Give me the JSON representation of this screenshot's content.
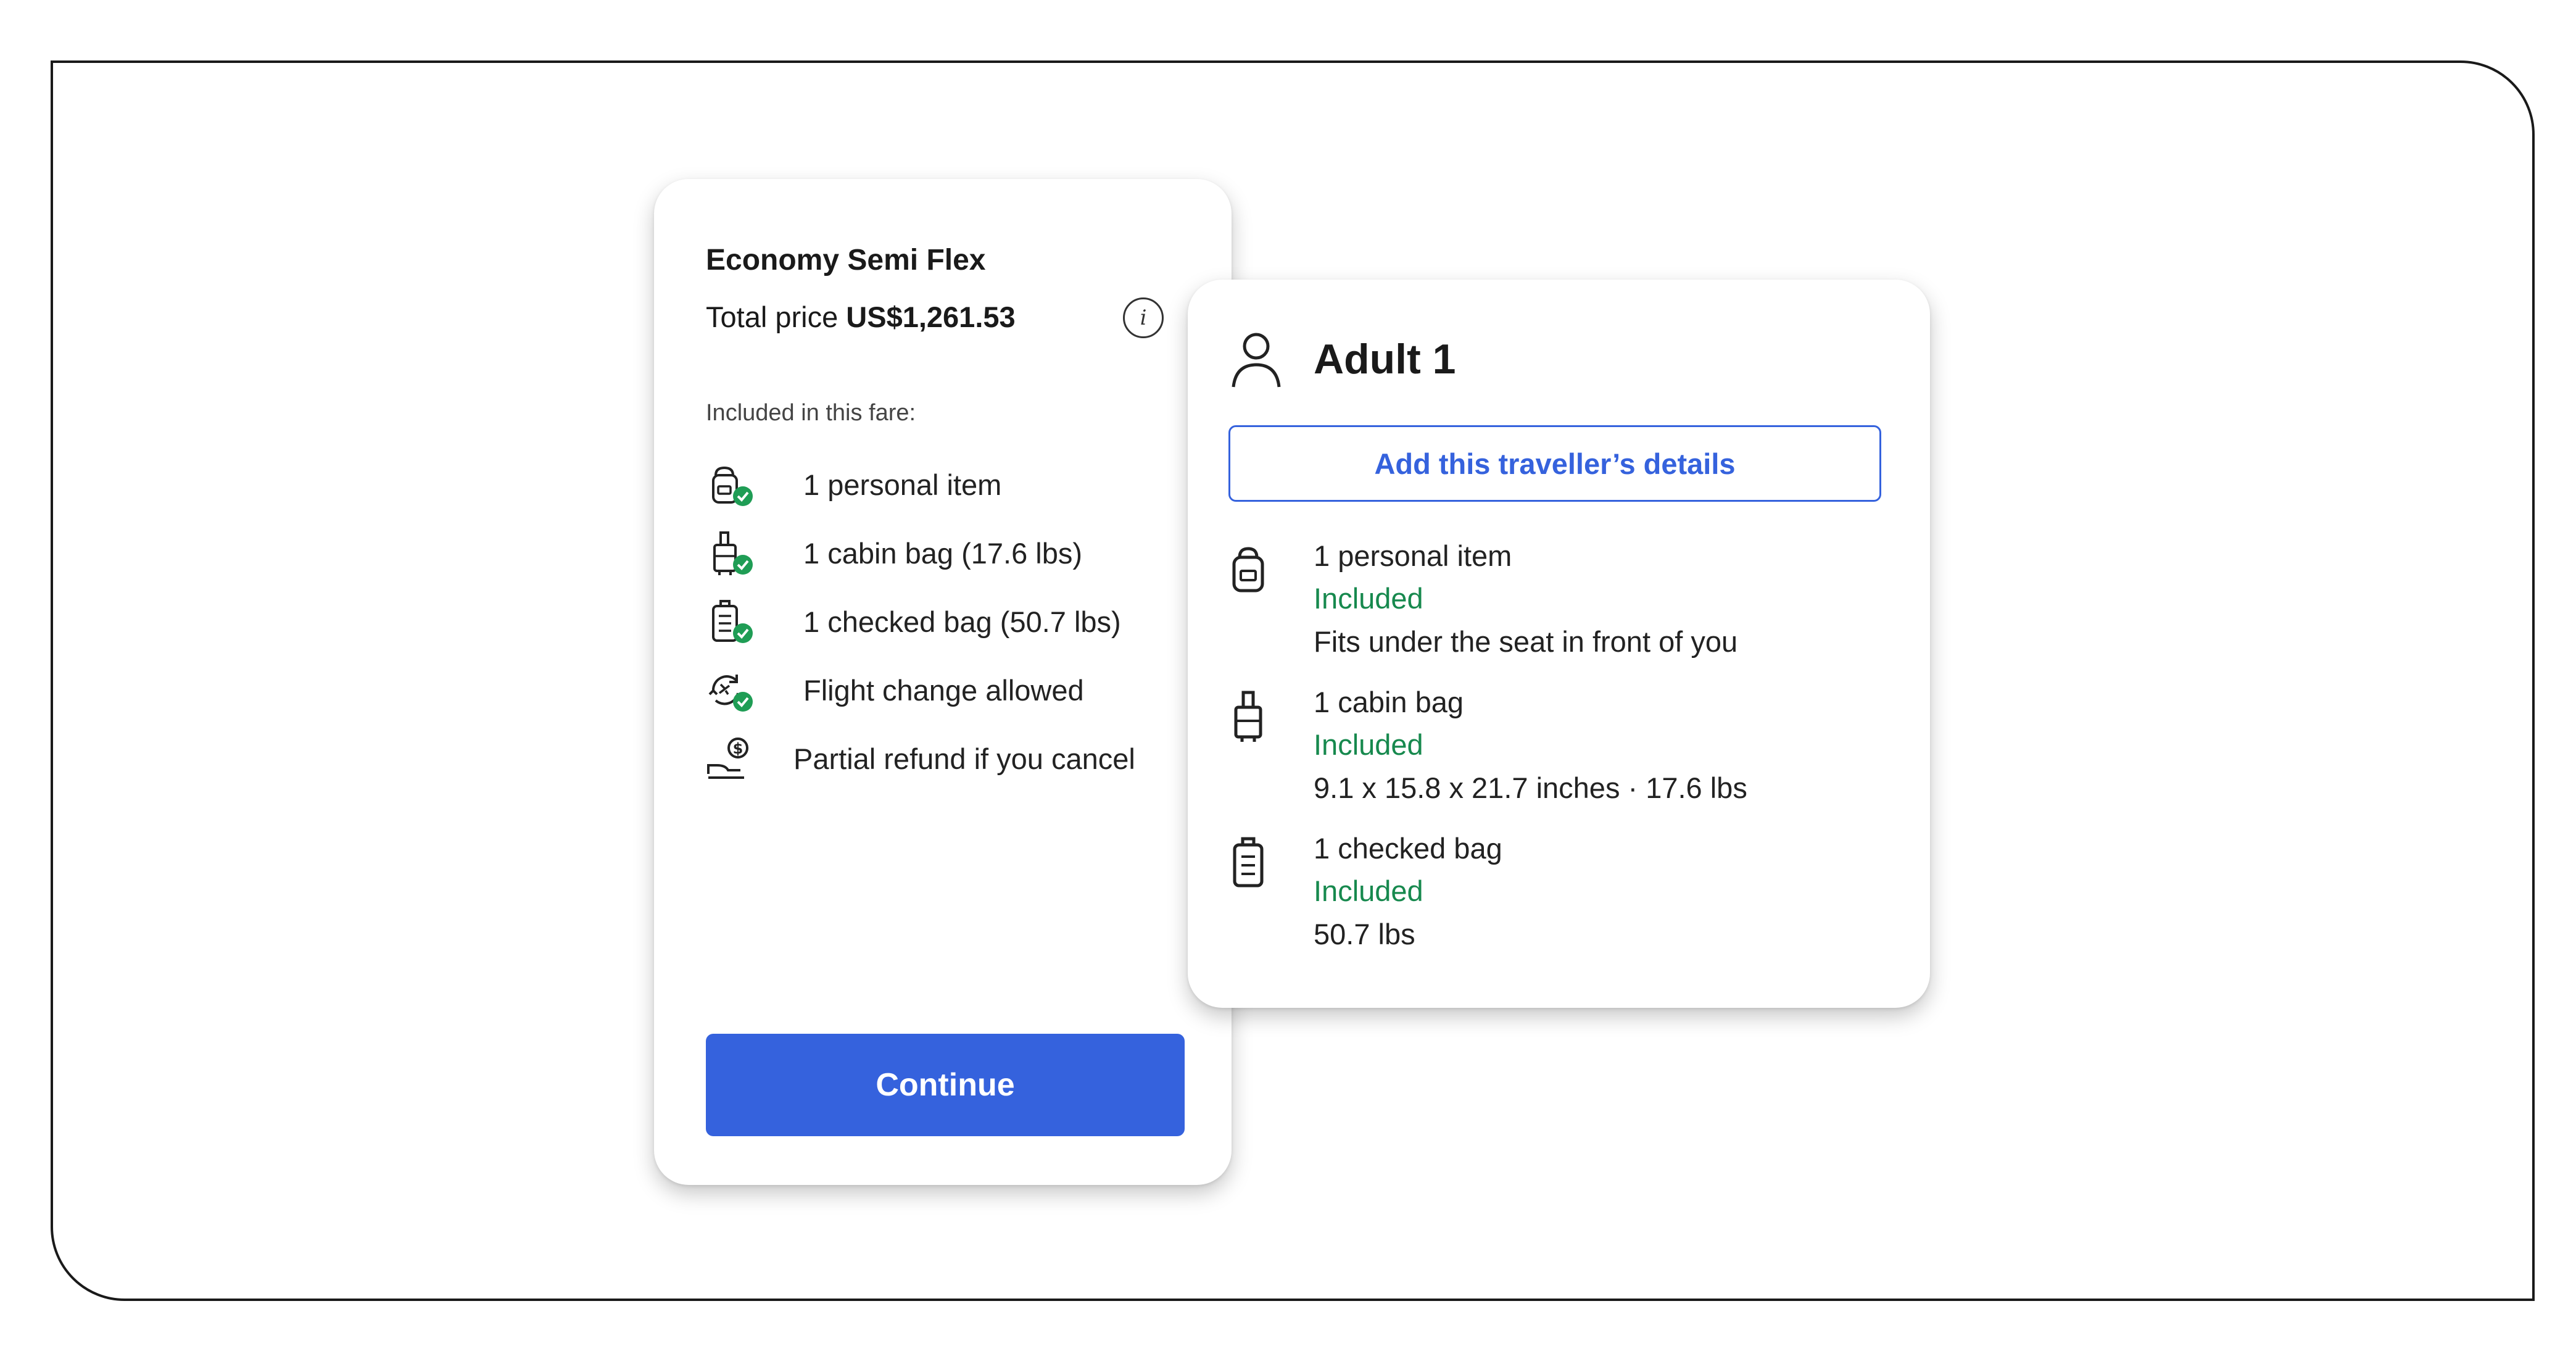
{
  "fare": {
    "name": "Economy Semi Flex",
    "price_prefix": "Total price",
    "price": "US$1,261.53",
    "included_label": "Included in this fare:",
    "features": [
      {
        "icon": "personal-item-check-icon",
        "label": "1 personal item"
      },
      {
        "icon": "cabin-bag-check-icon",
        "label": "1 cabin bag (17.6 lbs)"
      },
      {
        "icon": "checked-bag-check-icon",
        "label": "1 checked bag (50.7 lbs)"
      },
      {
        "icon": "flight-change-check-icon",
        "label": "Flight change allowed"
      },
      {
        "icon": "refund-icon",
        "label": "Partial refund if you cancel"
      }
    ],
    "continue_label": "Continue"
  },
  "traveller": {
    "title": "Adult 1",
    "add_details_label": "Add this traveller’s details",
    "bags": [
      {
        "icon": "personal-item-icon",
        "name": "1 personal item",
        "status": "Included",
        "detail": "Fits under the seat in front of you"
      },
      {
        "icon": "cabin-bag-icon",
        "name": "1 cabin bag",
        "status": "Included",
        "detail": "9.1 x 15.8 x 21.7 inches · 17.6 lbs"
      },
      {
        "icon": "checked-bag-icon",
        "name": "1 checked bag",
        "status": "Included",
        "detail": "50.7 lbs"
      }
    ]
  },
  "colors": {
    "accent": "#3562dd",
    "included_green": "#17894e",
    "check_badge": "#1f9d55"
  }
}
